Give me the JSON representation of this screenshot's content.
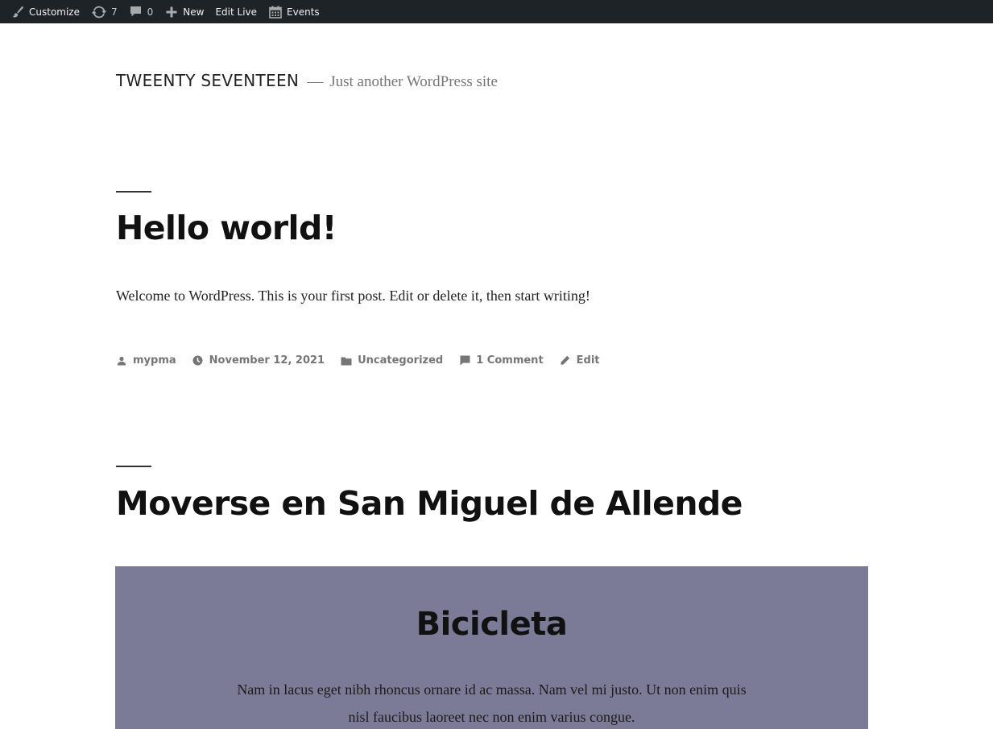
{
  "admin_bar": {
    "customize_label": "Customize",
    "updates_count": "7",
    "comments_count": "0",
    "new_label": "New",
    "edit_live_label": "Edit Live",
    "events_label": "Events"
  },
  "site": {
    "title": "TWEENTY SEVENTEEN",
    "separator": "—",
    "description": "Just another WordPress site"
  },
  "posts": [
    {
      "title": "Hello world!",
      "excerpt": "Welcome to WordPress. This is your first post. Edit or delete it, then start writing!",
      "meta": {
        "author": "mypma",
        "date": "November 12, 2021",
        "category": "Uncategorized",
        "comments": "1 Comment",
        "edit": "Edit"
      }
    },
    {
      "title": "Moverse en San Miguel de Allende",
      "cover": {
        "heading": "Bicicleta",
        "text": "Nam in lacus eget nibh rhoncus ornare id ac massa. Nam vel mi justo. Ut non enim quis nisl faucibus laoreet nec non enim varius congue.",
        "background": "#7c7b97"
      }
    }
  ],
  "icons": {
    "customize": "brush-icon",
    "updates": "updates-icon",
    "comments": "comment-icon",
    "new": "plus-icon",
    "events": "calendar-icon",
    "author": "person-icon",
    "date": "clock-icon",
    "category": "folder-icon",
    "comment_meta": "comment-icon",
    "edit": "pencil-icon"
  },
  "colors": {
    "admin_bar_bg": "#1d2327",
    "meta_text": "#767676",
    "cover_bg": "#7c7b97"
  }
}
